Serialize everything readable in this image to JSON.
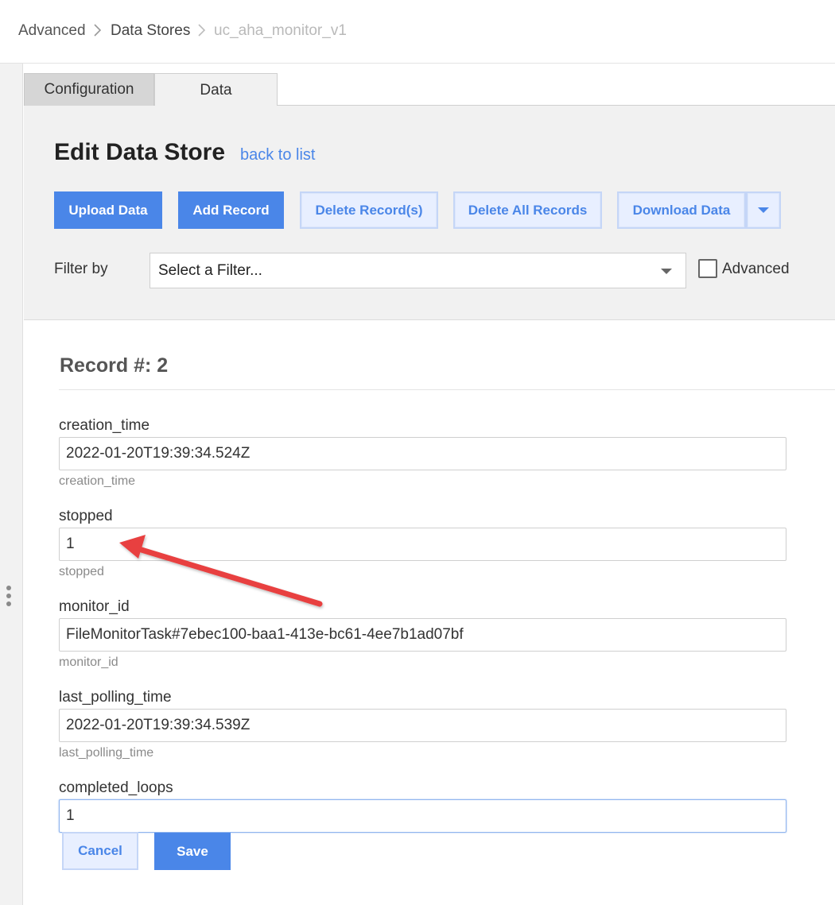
{
  "breadcrumb": {
    "items": [
      "Advanced",
      "Data Stores",
      "uc_aha_monitor_v1"
    ]
  },
  "tabs": [
    {
      "label": "Configuration",
      "active": false
    },
    {
      "label": "Data",
      "active": true
    }
  ],
  "header": {
    "title": "Edit Data Store",
    "back_link": "back to list"
  },
  "toolbar": {
    "upload_label": "Upload Data",
    "add_label": "Add Record",
    "delete_records_label": "Delete Record(s)",
    "delete_all_label": "Delete All Records",
    "download_label": "Download Data"
  },
  "filter": {
    "label": "Filter by",
    "placeholder": "Select a Filter...",
    "advanced_label": "Advanced",
    "advanced_checked": false
  },
  "record": {
    "title": "Record #: 2",
    "fields": [
      {
        "label": "creation_time",
        "value": "2022-01-20T19:39:34.524Z",
        "help": "creation_time"
      },
      {
        "label": "stopped",
        "value": "1",
        "help": "stopped"
      },
      {
        "label": "monitor_id",
        "value": "FileMonitorTask#7ebec100-baa1-413e-bc61-4ee7b1ad07bf",
        "help": "monitor_id"
      },
      {
        "label": "last_polling_time",
        "value": "2022-01-20T19:39:34.539Z",
        "help": "last_polling_time"
      },
      {
        "label": "completed_loops",
        "value": "1"
      }
    ]
  },
  "actions": {
    "cancel_label": "Cancel",
    "save_label": "Save"
  },
  "colors": {
    "accent": "#4a86e8",
    "annotation_arrow": "#e8403f"
  },
  "icons": [
    "chevron-right-icon",
    "caret-down-icon",
    "drag-handle-icon",
    "annotation-arrow"
  ]
}
